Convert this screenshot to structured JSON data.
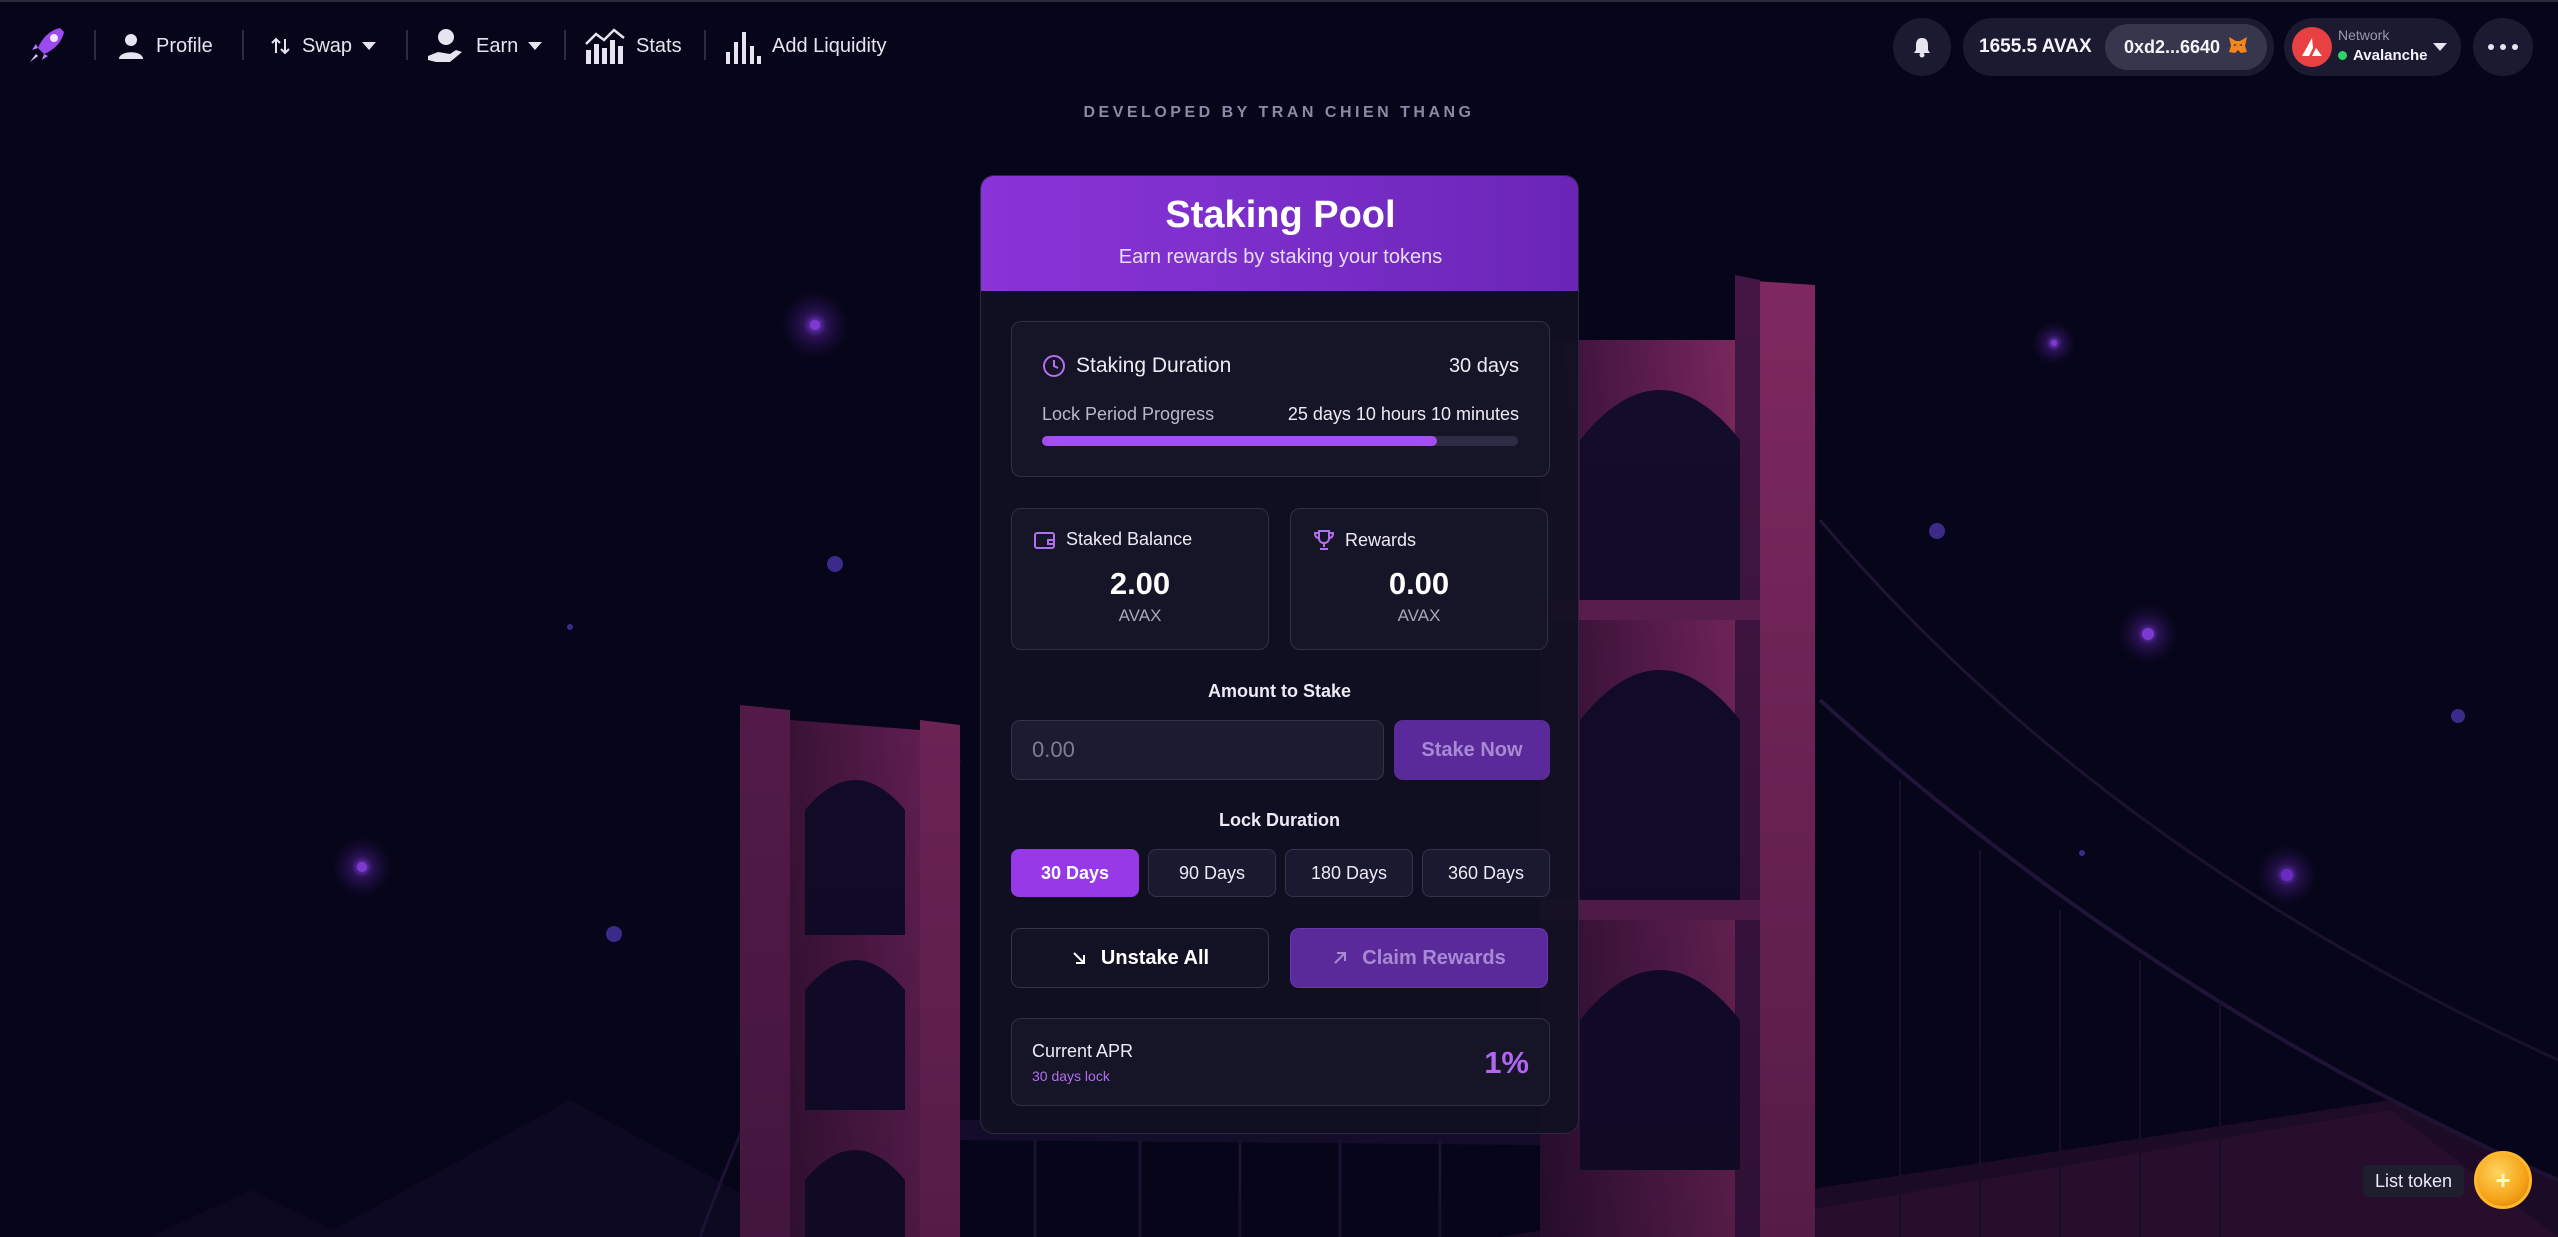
{
  "nav": {
    "profile": "Profile",
    "swap": "Swap",
    "earn": "Earn",
    "stats": "Stats",
    "add_liquidity": "Add Liquidity"
  },
  "wallet": {
    "balance": "1655.5 AVAX",
    "address": "0xd2...6640"
  },
  "network": {
    "label": "Network",
    "name": "Avalanche",
    "status_color": "#2fd36a"
  },
  "developer_credit": "DEVELOPED BY TRAN CHIEN THANG",
  "card": {
    "title": "Staking Pool",
    "subtitle": "Earn rewards by staking your tokens",
    "staking_duration_label": "Staking Duration",
    "staking_duration_value": "30 days",
    "lock_progress_label": "Lock Period Progress",
    "lock_progress_value": "25 days 10 hours 10 minutes",
    "lock_progress_fraction": 0.83,
    "staked_balance": {
      "label": "Staked Balance",
      "value": "2.00",
      "unit": "AVAX"
    },
    "rewards": {
      "label": "Rewards",
      "value": "0.00",
      "unit": "AVAX"
    },
    "amount_label": "Amount to Stake",
    "amount_placeholder": "0.00",
    "stake_button": "Stake Now",
    "lock_duration_label": "Lock Duration",
    "durations": [
      "30 Days",
      "90 Days",
      "180 Days",
      "360 Days"
    ],
    "selected_duration": "30 Days",
    "unstake_button": "Unstake All",
    "claim_button": "Claim Rewards",
    "apr_label": "Current APR",
    "apr_sub": "30 days lock",
    "apr_value": "1%"
  },
  "list_token": "List token",
  "colors": {
    "accent": "#9739e6",
    "background": "#07051a",
    "avalanche_red": "#e84142"
  }
}
